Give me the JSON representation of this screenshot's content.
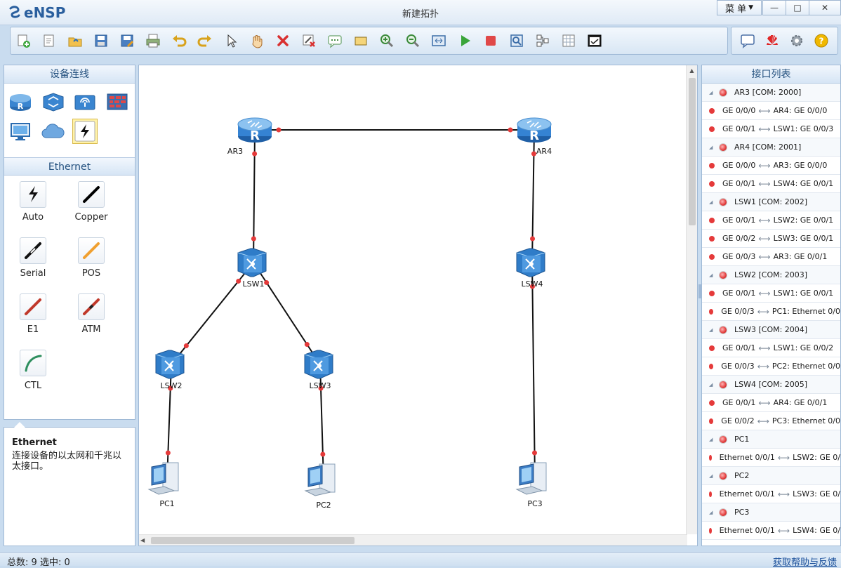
{
  "app": {
    "brand": "eNSP",
    "window_title": "新建拓扑",
    "menu_label": "菜 单",
    "controls": {
      "minimize": "—",
      "maximize": "□",
      "close": "✕"
    }
  },
  "toolbar": {
    "icons": [
      "new-topology-icon",
      "new-document-icon",
      "open-folder-icon",
      "save-icon",
      "save-as-icon",
      "print-icon",
      "undo-icon",
      "redo-icon",
      "select-pointer-icon",
      "pan-hand-icon",
      "delete-icon",
      "delete-link-icon",
      "text-comment-icon",
      "rectangle-label-icon",
      "zoom-in-icon",
      "zoom-out-icon",
      "fit-screen-icon",
      "start-device-icon",
      "stop-device-icon",
      "capture-data-icon",
      "topology-layout-icon",
      "palette-icon",
      "console-icon"
    ],
    "right_icons": [
      "chat-icon",
      "huawei-logo-icon",
      "gear-icon",
      "help-icon"
    ]
  },
  "left_panel": {
    "title": "设备连线",
    "devices": [
      {
        "name": "router-category",
        "icon": "router-icon"
      },
      {
        "name": "switch-category",
        "icon": "switch-icon"
      },
      {
        "name": "wireless-category",
        "icon": "wireless-ap-icon"
      },
      {
        "name": "firewall-category",
        "icon": "firewall-icon"
      },
      {
        "name": "terminal-category",
        "icon": "pc-monitor-icon"
      },
      {
        "name": "cloud-category",
        "icon": "cloud-icon"
      },
      {
        "name": "cable-category",
        "icon": "lightning-cable-icon"
      }
    ],
    "section_title": "Ethernet",
    "cables": [
      {
        "label": "Auto",
        "color": "#000000"
      },
      {
        "label": "Copper",
        "color": "#000000"
      },
      {
        "label": "Serial",
        "color": "#000000"
      },
      {
        "label": "POS",
        "color": "#f0a030"
      },
      {
        "label": "E1",
        "color": "#c0392b"
      },
      {
        "label": "ATM",
        "color": "#c0392b"
      },
      {
        "label": "CTL",
        "color": "#2f8f5f"
      }
    ]
  },
  "description": {
    "title": "Ethernet",
    "text": "连接设备的以太网和千兆以太接口。"
  },
  "topology": {
    "nodes": [
      {
        "id": "AR3",
        "label": "AR3",
        "type": "router"
      },
      {
        "id": "AR4",
        "label": "AR4",
        "type": "router"
      },
      {
        "id": "LSW1",
        "label": "LSW1",
        "type": "switch"
      },
      {
        "id": "LSW4",
        "label": "LSW4",
        "type": "switch"
      },
      {
        "id": "LSW2",
        "label": "LSW2",
        "type": "switch"
      },
      {
        "id": "LSW3",
        "label": "LSW3",
        "type": "switch"
      },
      {
        "id": "PC1",
        "label": "PC1",
        "type": "pc"
      },
      {
        "id": "PC2",
        "label": "PC2",
        "type": "pc"
      },
      {
        "id": "PC3",
        "label": "PC3",
        "type": "pc"
      }
    ],
    "links": [
      [
        "AR3",
        "AR4"
      ],
      [
        "AR3",
        "LSW1"
      ],
      [
        "AR4",
        "LSW4"
      ],
      [
        "LSW1",
        "LSW2"
      ],
      [
        "LSW1",
        "LSW3"
      ],
      [
        "LSW2",
        "PC1"
      ],
      [
        "LSW3",
        "PC2"
      ],
      [
        "LSW4",
        "PC3"
      ]
    ]
  },
  "interface_panel": {
    "title": "接口列表",
    "groups": [
      {
        "device": "AR3 [COM: 2000]",
        "links": [
          [
            "GE 0/0/0",
            "AR4: GE 0/0/0"
          ],
          [
            "GE 0/0/1",
            "LSW1: GE 0/0/3"
          ]
        ]
      },
      {
        "device": "AR4 [COM: 2001]",
        "links": [
          [
            "GE 0/0/0",
            "AR3: GE 0/0/0"
          ],
          [
            "GE 0/0/1",
            "LSW4: GE 0/0/1"
          ]
        ]
      },
      {
        "device": "LSW1 [COM: 2002]",
        "links": [
          [
            "GE 0/0/1",
            "LSW2: GE 0/0/1"
          ],
          [
            "GE 0/0/2",
            "LSW3: GE 0/0/1"
          ],
          [
            "GE 0/0/3",
            "AR3: GE 0/0/1"
          ]
        ]
      },
      {
        "device": "LSW2 [COM: 2003]",
        "links": [
          [
            "GE 0/0/1",
            "LSW1: GE 0/0/1"
          ],
          [
            "GE 0/0/3",
            "PC1: Ethernet 0/0"
          ]
        ]
      },
      {
        "device": "LSW3 [COM: 2004]",
        "links": [
          [
            "GE 0/0/1",
            "LSW1: GE 0/0/2"
          ],
          [
            "GE 0/0/3",
            "PC2: Ethernet 0/0"
          ]
        ]
      },
      {
        "device": "LSW4 [COM: 2005]",
        "links": [
          [
            "GE 0/0/1",
            "AR4: GE 0/0/1"
          ],
          [
            "GE 0/0/2",
            "PC3: Ethernet 0/0"
          ]
        ]
      },
      {
        "device": "PC1",
        "links": [
          [
            "Ethernet 0/0/1",
            "LSW2: GE 0/"
          ]
        ]
      },
      {
        "device": "PC2",
        "links": [
          [
            "Ethernet 0/0/1",
            "LSW3: GE 0/"
          ]
        ]
      },
      {
        "device": "PC3",
        "links": [
          [
            "Ethernet 0/0/1",
            "LSW4: GE 0/"
          ]
        ]
      }
    ]
  },
  "status": {
    "total_label": "总数:",
    "total": "9",
    "selected_label": "选中:",
    "selected": "0",
    "help_link": "获取帮助与反馈"
  }
}
